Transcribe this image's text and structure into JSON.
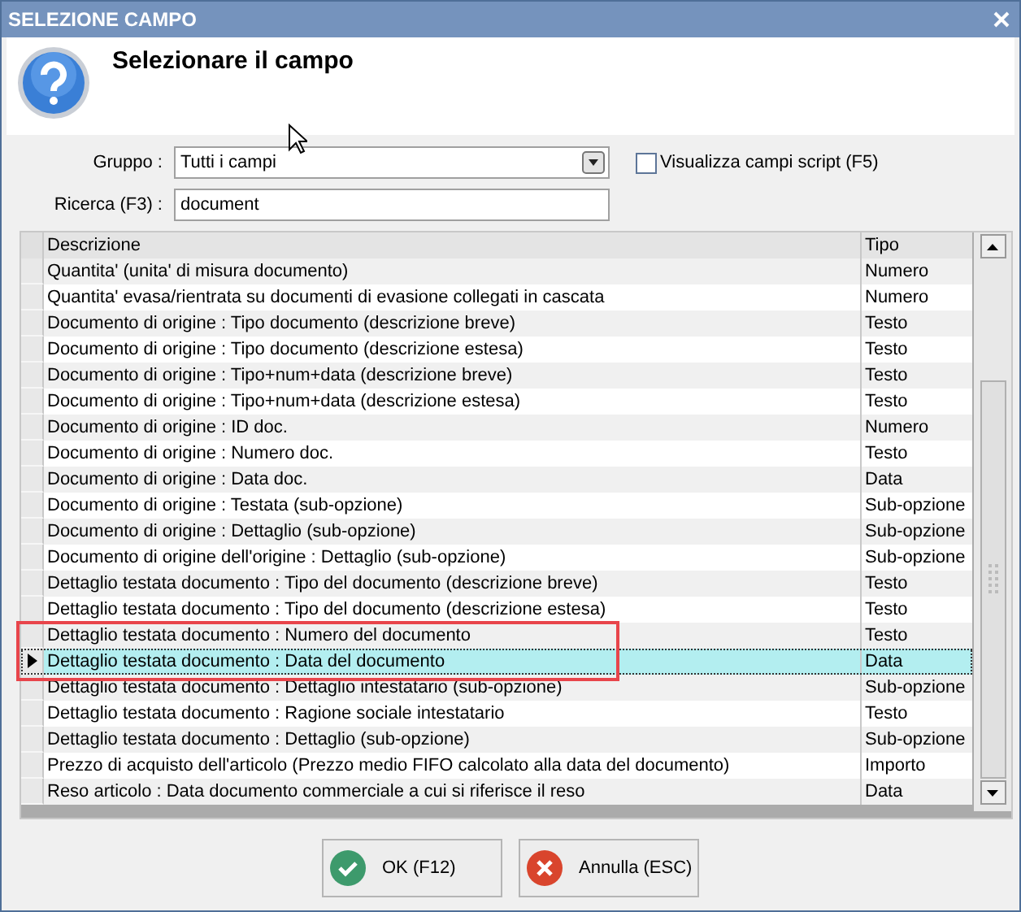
{
  "window": {
    "title": "SELEZIONE CAMPO"
  },
  "header": {
    "title": "Selezionare il campo"
  },
  "filters": {
    "group_label": "Gruppo :",
    "group_value": "Tutti i campi",
    "show_script": {
      "label": "Visualizza campi script (F5)",
      "checked": false
    },
    "search_label": "Ricerca (F3) :",
    "search_value": "document"
  },
  "table": {
    "columns": [
      "Descrizione",
      "Tipo"
    ],
    "rows": [
      {
        "descrizione": "Quantita' (unita' di misura documento)",
        "tipo": "Numero",
        "selected": false
      },
      {
        "descrizione": "Quantita' evasa/rientrata su documenti di evasione collegati in cascata",
        "tipo": "Numero",
        "selected": false
      },
      {
        "descrizione": "Documento di origine : Tipo documento (descrizione breve)",
        "tipo": "Testo",
        "selected": false
      },
      {
        "descrizione": "Documento di origine : Tipo documento (descrizione estesa)",
        "tipo": "Testo",
        "selected": false
      },
      {
        "descrizione": "Documento di origine : Tipo+num+data (descrizione breve)",
        "tipo": "Testo",
        "selected": false
      },
      {
        "descrizione": "Documento di origine : Tipo+num+data (descrizione estesa)",
        "tipo": "Testo",
        "selected": false
      },
      {
        "descrizione": "Documento di origine : ID doc.",
        "tipo": "Numero",
        "selected": false
      },
      {
        "descrizione": "Documento di origine : Numero doc.",
        "tipo": "Testo",
        "selected": false
      },
      {
        "descrizione": "Documento di origine : Data doc.",
        "tipo": "Data",
        "selected": false
      },
      {
        "descrizione": "Documento di origine : Testata (sub-opzione)",
        "tipo": "Sub-opzione",
        "selected": false
      },
      {
        "descrizione": "Documento di origine : Dettaglio (sub-opzione)",
        "tipo": "Sub-opzione",
        "selected": false
      },
      {
        "descrizione": "Documento di origine dell'origine : Dettaglio (sub-opzione)",
        "tipo": "Sub-opzione",
        "selected": false
      },
      {
        "descrizione": "Dettaglio testata documento : Tipo del documento (descrizione breve)",
        "tipo": "Testo",
        "selected": false
      },
      {
        "descrizione": "Dettaglio testata documento : Tipo del documento (descrizione estesa)",
        "tipo": "Testo",
        "selected": false
      },
      {
        "descrizione": "Dettaglio testata documento : Numero del documento",
        "tipo": "Testo",
        "selected": false
      },
      {
        "descrizione": "Dettaglio testata documento : Data del documento",
        "tipo": "Data",
        "selected": true
      },
      {
        "descrizione": "Dettaglio testata documento : Dettaglio intestatario (sub-opzione)",
        "tipo": "Sub-opzione",
        "selected": false
      },
      {
        "descrizione": "Dettaglio testata documento : Ragione sociale intestatario",
        "tipo": "Testo",
        "selected": false
      },
      {
        "descrizione": "Dettaglio testata documento : Dettaglio (sub-opzione)",
        "tipo": "Sub-opzione",
        "selected": false
      },
      {
        "descrizione": "Prezzo di acquisto dell'articolo (Prezzo medio FIFO calcolato alla data del documento)",
        "tipo": "Importo",
        "selected": false
      },
      {
        "descrizione": "Reso articolo : Data documento commerciale a cui si riferisce il reso",
        "tipo": "Data",
        "selected": false
      }
    ]
  },
  "buttons": [
    {
      "kind": "ok",
      "label": "OK (F12)"
    },
    {
      "kind": "cancel",
      "label": "Annulla (ESC)"
    }
  ]
}
